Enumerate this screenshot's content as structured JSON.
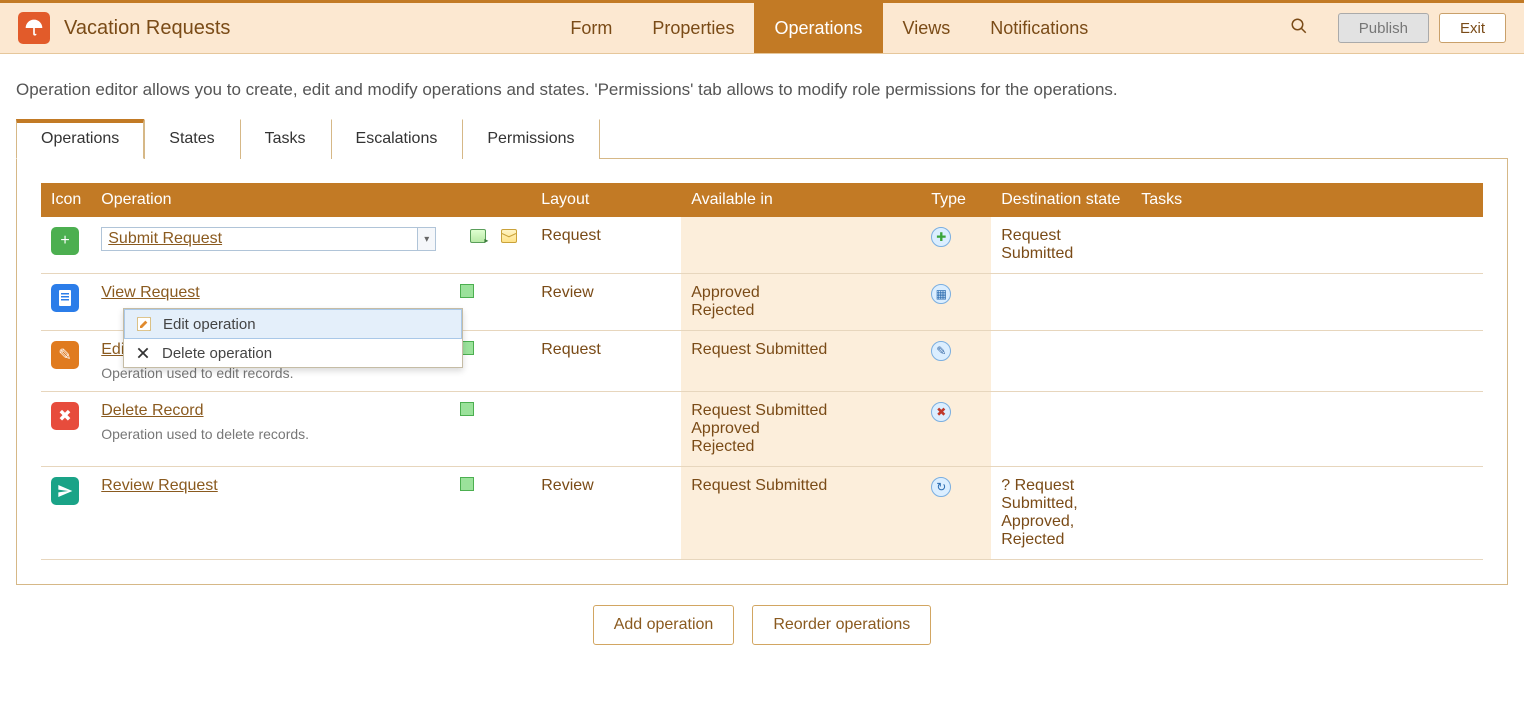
{
  "app": {
    "title": "Vacation Requests",
    "nav": [
      "Form",
      "Properties",
      "Operations",
      "Views",
      "Notifications"
    ],
    "nav_active": 2,
    "btn_publish": "Publish",
    "btn_exit": "Exit"
  },
  "help": "Operation editor allows you to create, edit and modify operations and states. 'Permissions' tab allows to modify role permissions for the operations.",
  "tabs": [
    "Operations",
    "States",
    "Tasks",
    "Escalations",
    "Permissions"
  ],
  "tabs_active": 0,
  "table": {
    "headers": [
      "Icon",
      "Operation",
      "",
      "Layout",
      "Available in",
      "Type",
      "Destination state",
      "Tasks"
    ],
    "rows": [
      {
        "icon": {
          "cls": "ic-green",
          "glyph": "+",
          "name": "add-icon"
        },
        "name": "Submit Request",
        "dropdown": true,
        "extras": true,
        "layout": "Request",
        "available": "",
        "type": {
          "glyph": "✚",
          "cls": "type-add",
          "name": "type-add-icon"
        },
        "dest": "Request Submitted",
        "tasks": ""
      },
      {
        "icon": {
          "cls": "ic-blue",
          "glyph": "📄",
          "name": "document-icon"
        },
        "name": "View Request",
        "layout": "Review",
        "available": "Approved\nRejected",
        "type": {
          "glyph": "▦",
          "cls": "type-view",
          "name": "type-view-icon"
        },
        "dest": "",
        "tasks": ""
      },
      {
        "icon": {
          "cls": "ic-orange",
          "glyph": "✎",
          "name": "edit-icon"
        },
        "name": "Edit Record",
        "desc": "Operation used to edit records.",
        "layout": "Request",
        "available": "Request Submitted",
        "type": {
          "glyph": "✎",
          "cls": "type-edit",
          "name": "type-edit-icon"
        },
        "dest": "",
        "tasks": ""
      },
      {
        "icon": {
          "cls": "ic-red",
          "glyph": "✖",
          "name": "delete-icon"
        },
        "name": "Delete Record",
        "desc": "Operation used to delete records.",
        "layout": "",
        "available": "Request Submitted\nApproved\nRejected",
        "type": {
          "glyph": "✖",
          "cls": "type-delete",
          "name": "type-delete-icon"
        },
        "dest": "",
        "tasks": ""
      },
      {
        "icon": {
          "cls": "ic-teal",
          "glyph": "➤",
          "name": "send-icon"
        },
        "name": "Review Request",
        "layout": "Review",
        "available": "Request Submitted",
        "type": {
          "glyph": "↻",
          "cls": "type-review",
          "name": "type-transition-icon"
        },
        "dest": "? Request Submitted, Approved, Rejected",
        "tasks": ""
      }
    ]
  },
  "context_menu": {
    "items": [
      "Edit operation",
      "Delete operation"
    ]
  },
  "footer": {
    "add": "Add operation",
    "reorder": "Reorder operations"
  }
}
